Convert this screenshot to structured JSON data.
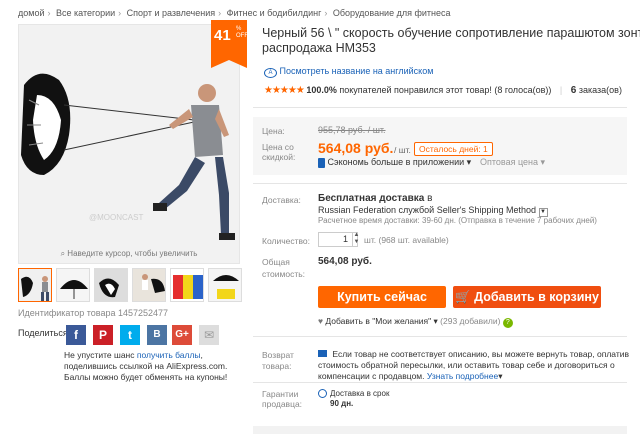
{
  "breadcrumb": [
    "домой",
    "Все категории",
    "Спорт и развлечения",
    "Фитнес и бодибилдинг",
    "Оборудование для фитнеса"
  ],
  "gallery": {
    "discount": "41",
    "discount_small_top": "%",
    "discount_small_bottom": "OFF",
    "zoom_hint": "Наведите курсор, чтобы увеличить",
    "watermark": "@MOONCAST",
    "item_id": "Идентификатор товара 1457252477"
  },
  "share": {
    "label": "Поделиться:",
    "promo_before": "Не упустите шанс",
    "promo_link": "получить баллы",
    "promo_after": ", поделившись ссылкой на AliExpress.com. Баллы можно будет обменять на купоны!"
  },
  "product": {
    "title_line1": "Черный 56 \\ \" скорость обучение сопротивление парашютом зонт запус",
    "title_line2": "распродажа HM353",
    "translate_link": "Посмотреть название на английском",
    "rating_pct": "100.0%",
    "rating_text": "покупателей понравился этот товар! (8 голоса(ов))",
    "orders_count": "6",
    "orders_label": "заказа(ов)"
  },
  "price": {
    "label": "Цена:",
    "old": "955,78 руб. / шт.",
    "discount_label": "Цена со скидкой:",
    "new": "564,08 руб.",
    "per_unit": "/ шт.",
    "left_days": "Осталось дней: 1",
    "app_text": "Сэкономь больше в приложении",
    "wholesale": "Оптовая цена"
  },
  "shipping": {
    "label": "Доставка:",
    "free": "Бесплатная доставка",
    "in": "в",
    "method": "Russian Federation службой Seller's Shipping Method",
    "estimate": "Расчетное время доставки: 39-60 дн. (Отправка в течение 7 рабочих дней)"
  },
  "quantity": {
    "label": "Количество:",
    "value": "1",
    "available": "шт. (968 шт. available)"
  },
  "total": {
    "label": "Общая стоимость:",
    "value": "564,08 руб."
  },
  "buttons": {
    "buy": "Купить сейчас",
    "cart": "Добавить в корзину"
  },
  "wishlist": {
    "label": "Добавить в \"Мои желания\"",
    "count": "(293 добавили)"
  },
  "returns": {
    "label": "Возврат товара:",
    "text": "Если товар не соответствует описанию, вы можете вернуть товар, оплатив стоимость обратной пересылки, или оставить товар себе и договориться о компенсации с продавцом.",
    "link": "Узнать подробнее"
  },
  "guarantee": {
    "label": "Гарантии продавца:",
    "line1": "Доставка в срок",
    "line2": "90 дн."
  },
  "colors": {
    "accent": "#ff6600",
    "link": "#1a62b7",
    "cart_btn": "#f04e10"
  }
}
